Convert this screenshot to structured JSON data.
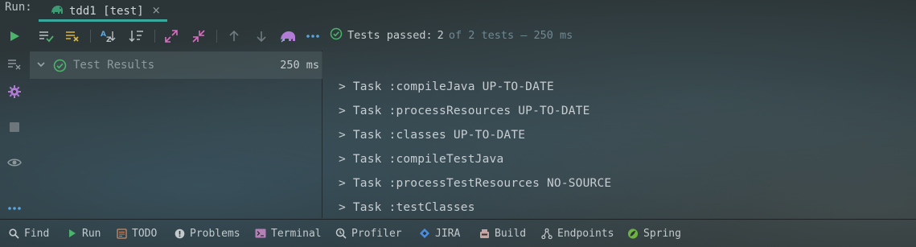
{
  "header": {
    "run_caption": "Run:",
    "tab_label": "tdd1 [test]",
    "tab_close": "×"
  },
  "toolbar": {
    "status_passed": "Tests passed:",
    "status_count": "2",
    "status_rest": "of 2 tests – 250 ms",
    "buttons": [
      "run-icon",
      "show-passed-icon",
      "show-ignored-icon",
      "sort-alpha-icon",
      "sort-duration-icon",
      "expand-all-icon",
      "collapse-all-icon",
      "previous-failed-icon",
      "next-failed-icon",
      "gradle-icon",
      "more-icon"
    ]
  },
  "left_strip": {
    "buttons": [
      "rerun-list-icon",
      "settings-icon",
      "stop-icon",
      "view-icon",
      "more-icon"
    ]
  },
  "tree": {
    "root_label": "Test Results",
    "root_time": "250 ms"
  },
  "console": {
    "lines": [
      "> Task :compileJava UP-TO-DATE",
      "> Task :processResources UP-TO-DATE",
      "> Task :classes UP-TO-DATE",
      "> Task :compileTestJava",
      "> Task :processTestResources NO-SOURCE",
      "> Task :testClasses"
    ]
  },
  "bottom_bar": {
    "items": [
      {
        "label": "Find",
        "icon": "search-icon"
      },
      {
        "label": "Run",
        "icon": "play-icon"
      },
      {
        "label": "TODO",
        "icon": "todo-icon"
      },
      {
        "label": "Problems",
        "icon": "problems-icon"
      },
      {
        "label": "Terminal",
        "icon": "terminal-icon"
      },
      {
        "label": "Profiler",
        "icon": "profiler-icon"
      },
      {
        "label": "JIRA",
        "icon": "jira-icon"
      },
      {
        "label": "Build",
        "icon": "build-icon"
      },
      {
        "label": "Endpoints",
        "icon": "endpoints-icon"
      },
      {
        "label": "Spring",
        "icon": "spring-icon"
      }
    ]
  },
  "colors": {
    "accent": "#3aa89c",
    "pass_green": "#4bb36b",
    "warn_yellow": "#d9b441",
    "icon_blue": "#5aa7e0",
    "purple": "#b27cd6"
  }
}
